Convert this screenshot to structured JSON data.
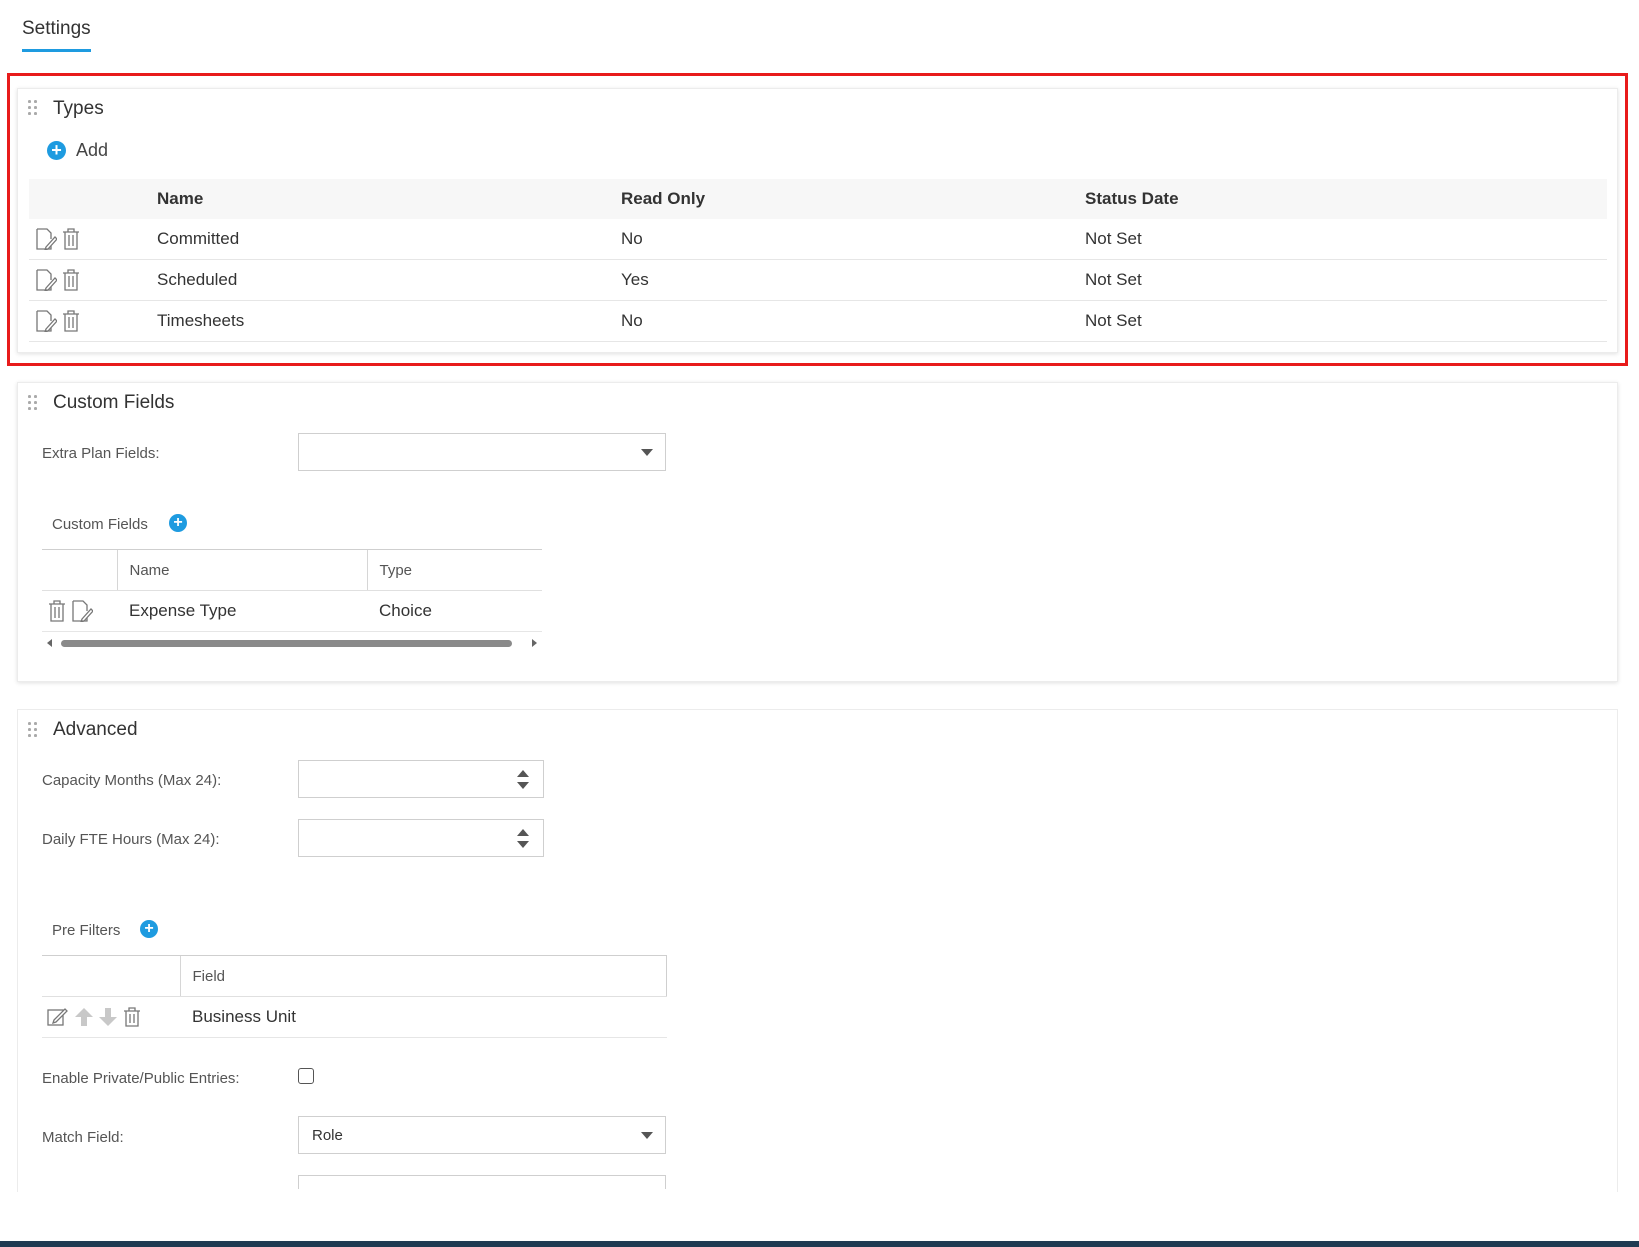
{
  "header": {
    "tab_label": "Settings"
  },
  "types_panel": {
    "title": "Types",
    "add_label": "Add",
    "columns": [
      "Name",
      "Read Only",
      "Status Date"
    ],
    "rows": [
      {
        "name": "Committed",
        "read_only": "No",
        "status_date": "Not Set"
      },
      {
        "name": "Scheduled",
        "read_only": "Yes",
        "status_date": "Not Set"
      },
      {
        "name": "Timesheets",
        "read_only": "No",
        "status_date": "Not Set"
      }
    ]
  },
  "custom_fields_panel": {
    "title": "Custom Fields",
    "extra_plan_fields_label": "Extra Plan Fields:",
    "extra_plan_fields_value": "",
    "subsection_title": "Custom Fields",
    "columns": [
      "Name",
      "Type"
    ],
    "rows": [
      {
        "name": "Expense Type",
        "type": "Choice"
      }
    ]
  },
  "advanced_panel": {
    "title": "Advanced",
    "capacity_months_label": "Capacity Months (Max 24):",
    "capacity_months_value": "",
    "daily_fte_label": "Daily FTE Hours (Max 24):",
    "daily_fte_value": "",
    "pre_filters_title": "Pre Filters",
    "pre_filters_column": "Field",
    "pre_filters_rows": [
      {
        "field": "Business Unit"
      }
    ],
    "private_public_label": "Enable Private/Public Entries:",
    "private_public_checked": false,
    "match_field_label": "Match Field:",
    "match_field_value": "Role"
  },
  "icons": {
    "edit": "edit-icon",
    "delete": "trash-icon",
    "add": "plus-circle-icon",
    "drag": "drag-handle-icon",
    "dropdown": "chevron-down-icon",
    "move_up": "arrow-up-icon",
    "move_down": "arrow-down-icon"
  },
  "colors": {
    "accent": "#1e9be0",
    "highlight_border": "#e81b1b",
    "bottom_bar": "#1f3a52"
  }
}
